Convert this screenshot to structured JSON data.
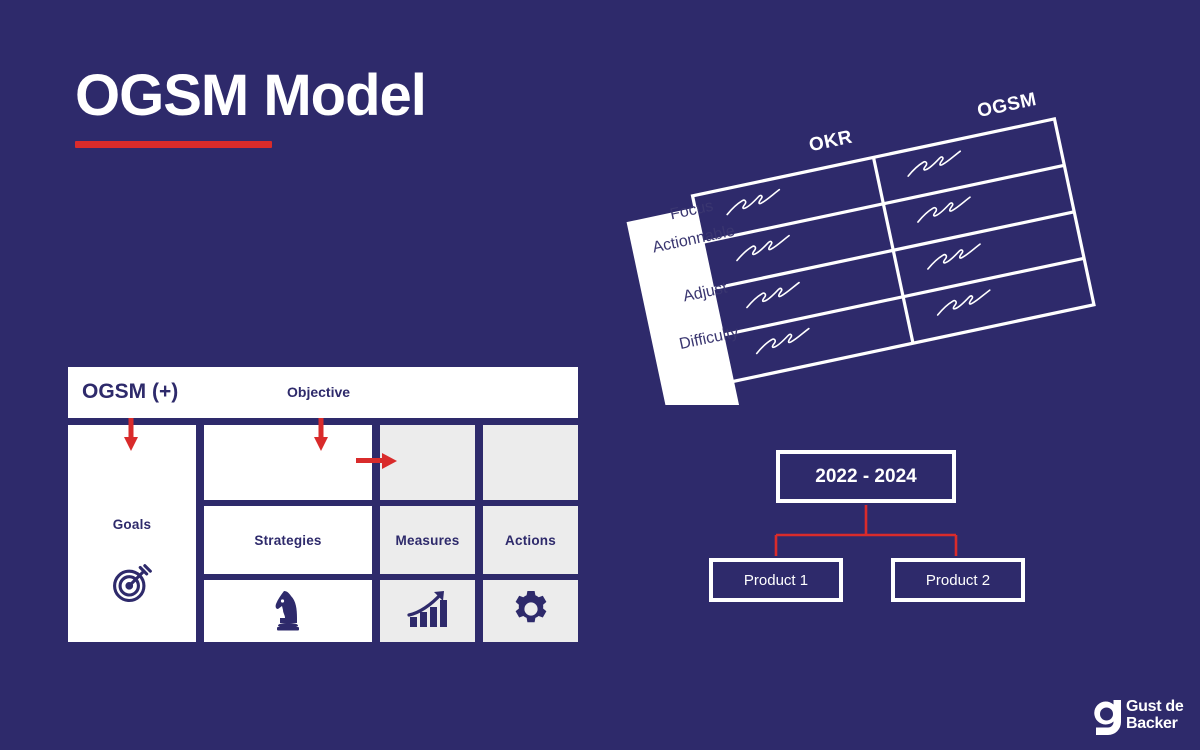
{
  "theme": {
    "background": "#2e2a6b",
    "accent_red": "#d92b2b",
    "white": "#ffffff",
    "cell_gray": "#ececec",
    "navy_text": "#2e2a6b"
  },
  "page": {
    "title": "OGSM Model"
  },
  "ogsm_table": {
    "header_title": "OGSM (+)",
    "header_objective": "Objective",
    "columns": [
      {
        "key": "goals",
        "label": "Goals",
        "icon": "target-icon",
        "fill": "white"
      },
      {
        "key": "strategies",
        "label": "Strategies",
        "icon": "chess-knight-icon",
        "fill": "white"
      },
      {
        "key": "measures",
        "label": "Measures",
        "icon": "bar-chart-icon",
        "fill": "gray"
      },
      {
        "key": "actions",
        "label": "Actions",
        "icon": "gear-icon",
        "fill": "gray"
      }
    ],
    "arrows": [
      {
        "name": "arrow-to-goals",
        "direction": "down"
      },
      {
        "name": "arrow-to-objective",
        "direction": "down"
      },
      {
        "name": "arrow-to-measures",
        "direction": "right"
      }
    ]
  },
  "comparison_table": {
    "column_headers": [
      "OKR",
      "OGSM"
    ],
    "row_labels": [
      "Focus",
      "Actionnable",
      "Adjust",
      "Difficulty"
    ],
    "cell_content": "scribble-placeholder",
    "rotation_degrees": -12
  },
  "product_tree": {
    "root": "2022 - 2024",
    "children": [
      "Product 1",
      "Product 2"
    ]
  },
  "logo": {
    "mark": "g-mark-icon",
    "line1": "Gust de",
    "line2": "Backer"
  }
}
